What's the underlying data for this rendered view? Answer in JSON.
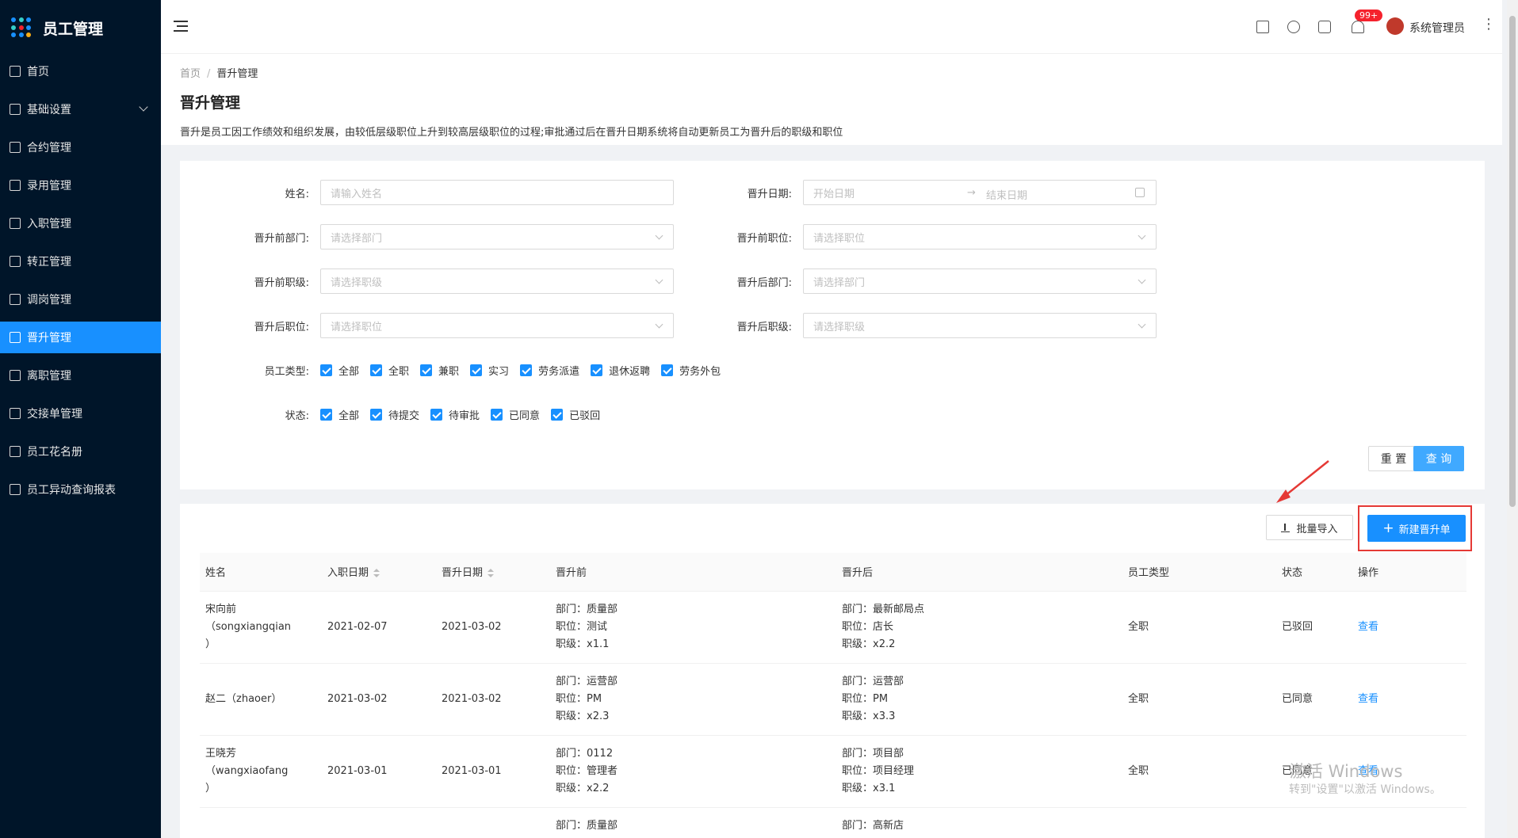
{
  "sidebar": {
    "title": "员工管理",
    "items": [
      {
        "label": "首页",
        "active": false
      },
      {
        "label": "基础设置",
        "active": false,
        "expandable": true
      },
      {
        "label": "合约管理",
        "active": false
      },
      {
        "label": "录用管理",
        "active": false
      },
      {
        "label": "入职管理",
        "active": false
      },
      {
        "label": "转正管理",
        "active": false
      },
      {
        "label": "调岗管理",
        "active": false
      },
      {
        "label": "晋升管理",
        "active": true
      },
      {
        "label": "离职管理",
        "active": false
      },
      {
        "label": "交接单管理",
        "active": false
      },
      {
        "label": "员工花名册",
        "active": false
      },
      {
        "label": "员工异动查询报表",
        "active": false
      }
    ]
  },
  "header": {
    "badge": "99+",
    "username": "系统管理员",
    "more": "⋮"
  },
  "page": {
    "breadcrumb_home": "首页",
    "breadcrumb_sep": "/",
    "breadcrumb_current": "晋升管理",
    "title": "晋升管理",
    "description": "晋升是员工因工作绩效和组织发展，由较低层级职位上升到较高层级职位的过程;审批通过后在晋升日期系统将自动更新员工为晋升后的职级和职位"
  },
  "filters": {
    "name_label": "姓名:",
    "name_placeholder": "请输入姓名",
    "date_label": "晋升日期:",
    "date_start": "开始日期",
    "date_arrow": "→",
    "date_end": "结束日期",
    "before_dept_label": "晋升前部门:",
    "before_dept_placeholder": "请选择部门",
    "before_pos_label": "晋升前职位:",
    "before_pos_placeholder": "请选择职位",
    "before_level_label": "晋升前职级:",
    "before_level_placeholder": "请选择职级",
    "after_dept_label": "晋升后部门:",
    "after_dept_placeholder": "请选择部门",
    "after_pos_label": "晋升后职位:",
    "after_pos_placeholder": "请选择职位",
    "after_level_label": "晋升后职级:",
    "after_level_placeholder": "请选择职级",
    "emp_type_label": "员工类型:",
    "emp_types": [
      "全部",
      "全职",
      "兼职",
      "实习",
      "劳务派遣",
      "退休返聘",
      "劳务外包"
    ],
    "status_label": "状态:",
    "statuses": [
      "全部",
      "待提交",
      "待审批",
      "已同意",
      "已驳回"
    ],
    "reset_label": "重 置",
    "query_label": "查 询"
  },
  "actions": {
    "import_label": "批量导入",
    "new_label": "新建晋升单",
    "new_plus": "+"
  },
  "table": {
    "columns": [
      "姓名",
      "入职日期",
      "晋升日期",
      "晋升前",
      "晋升后",
      "员工类型",
      "状态",
      "操作"
    ],
    "rows": [
      {
        "name": [
          "宋向前",
          "（songxiangqian",
          "）"
        ],
        "join": "2021-02-07",
        "promo": "2021-03-02",
        "before": [
          "部门：质量部",
          "职位：测试",
          "职级：x1.1"
        ],
        "after": [
          "部门：最新邮局点",
          "职位：店长",
          "职级：x2.2"
        ],
        "type": "全职",
        "status": "已驳回",
        "action": "查看"
      },
      {
        "name": [
          "赵二（zhaoer）"
        ],
        "join": "2021-03-02",
        "promo": "2021-03-02",
        "before": [
          "部门：运营部",
          "职位：PM",
          "职级：x2.3"
        ],
        "after": [
          "部门：运营部",
          "职位：PM",
          "职级：x3.3"
        ],
        "type": "全职",
        "status": "已同意",
        "action": "查看"
      },
      {
        "name": [
          "王晓芳",
          "（wangxiaofang",
          "）"
        ],
        "join": "2021-03-01",
        "promo": "2021-03-01",
        "before": [
          "部门：0112",
          "职位：管理者",
          "职级：x2.2"
        ],
        "after": [
          "部门：项目部",
          "职位：项目经理",
          "职级：x3.1"
        ],
        "type": "全职",
        "status": "已同意",
        "action": "查看"
      },
      {
        "name": [
          ""
        ],
        "join": "",
        "promo": "",
        "before": [
          "部门：质量部"
        ],
        "after": [
          "部门：高新店"
        ],
        "type": "",
        "status": "",
        "action": ""
      }
    ]
  },
  "watermark": {
    "line1": "激活 Windows",
    "line2": "转到\"设置\"以激活 Windows。"
  }
}
